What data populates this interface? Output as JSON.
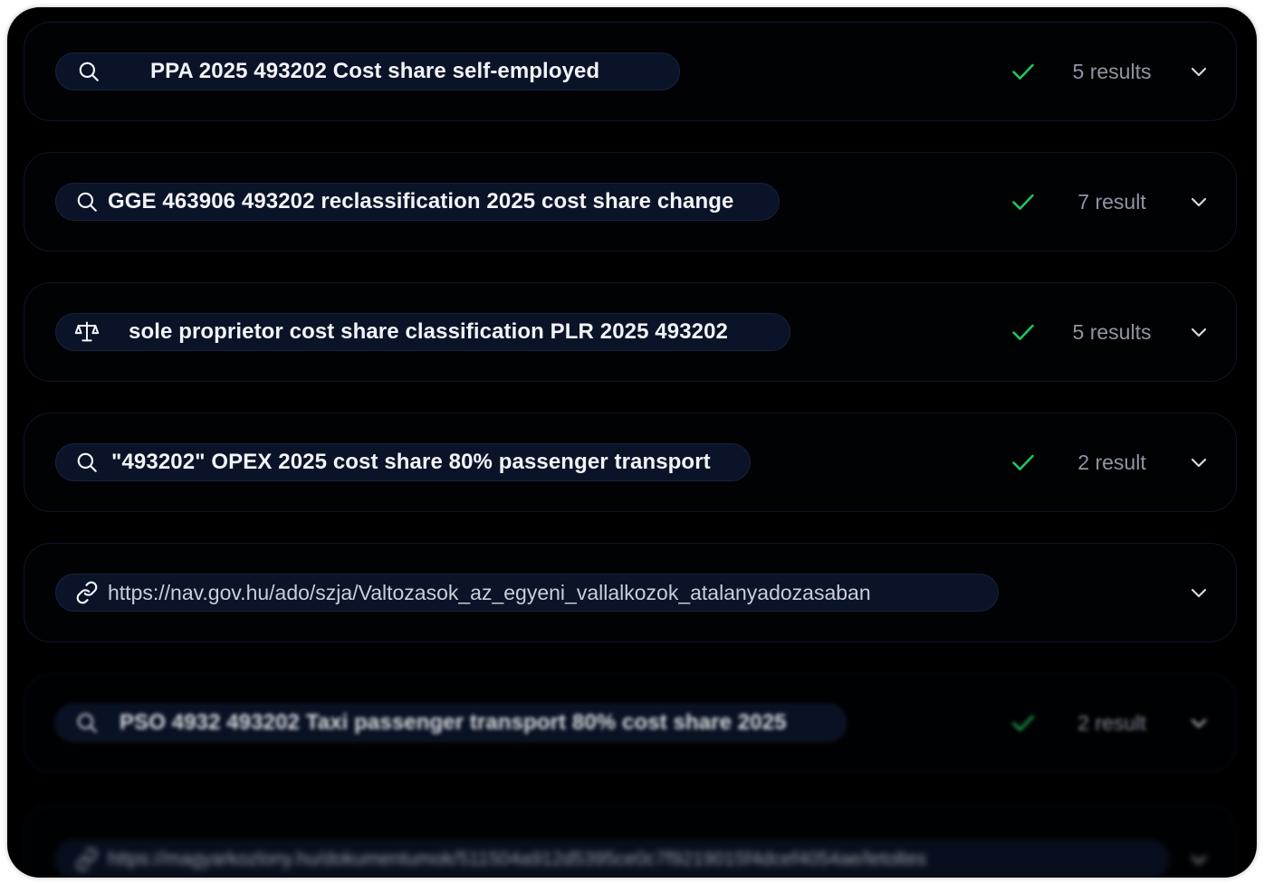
{
  "colors": {
    "background": "#000000",
    "pill_background": "#0a1328",
    "check_green": "#22c55e",
    "count_gray": "#8e95a3"
  },
  "searches": [
    {
      "type": "search",
      "icon": "search-icon",
      "text": "PPA 2025 493202 Cost share self-employed",
      "status": "check-icon",
      "count": "5 results"
    },
    {
      "type": "search",
      "icon": "search-icon",
      "text": "GGE 463906 493202 reclassification 2025 cost share change",
      "status": "check-icon",
      "count": "7 result"
    },
    {
      "type": "legal",
      "icon": "scales-icon",
      "text": "sole proprietor cost share classification PLR 2025 493202",
      "status": "check-icon",
      "count": "5 results"
    },
    {
      "type": "search",
      "icon": "search-icon",
      "text": "\"493202\" OPEX 2025 cost share 80% passenger transport",
      "status": "check-icon",
      "count": "2 result"
    },
    {
      "type": "link",
      "icon": "link-icon",
      "text": "https://nav.gov.hu/ado/szja/Valtozasok_az_egyeni_vallalkozok_atalanyadozasaban",
      "status": "",
      "count": ""
    },
    {
      "type": "search",
      "icon": "search-icon",
      "text": "PSO 4932 493202 Taxi passenger transport 80% cost share 2025",
      "status": "check-icon",
      "count": "2 result"
    },
    {
      "type": "link",
      "icon": "link-icon",
      "text": "https://magyarkozlony.hu/dokumentumok/511504a912d5395ce0c7f9219015f4dcef4054ae/letoltes",
      "status": "",
      "count": ""
    }
  ]
}
